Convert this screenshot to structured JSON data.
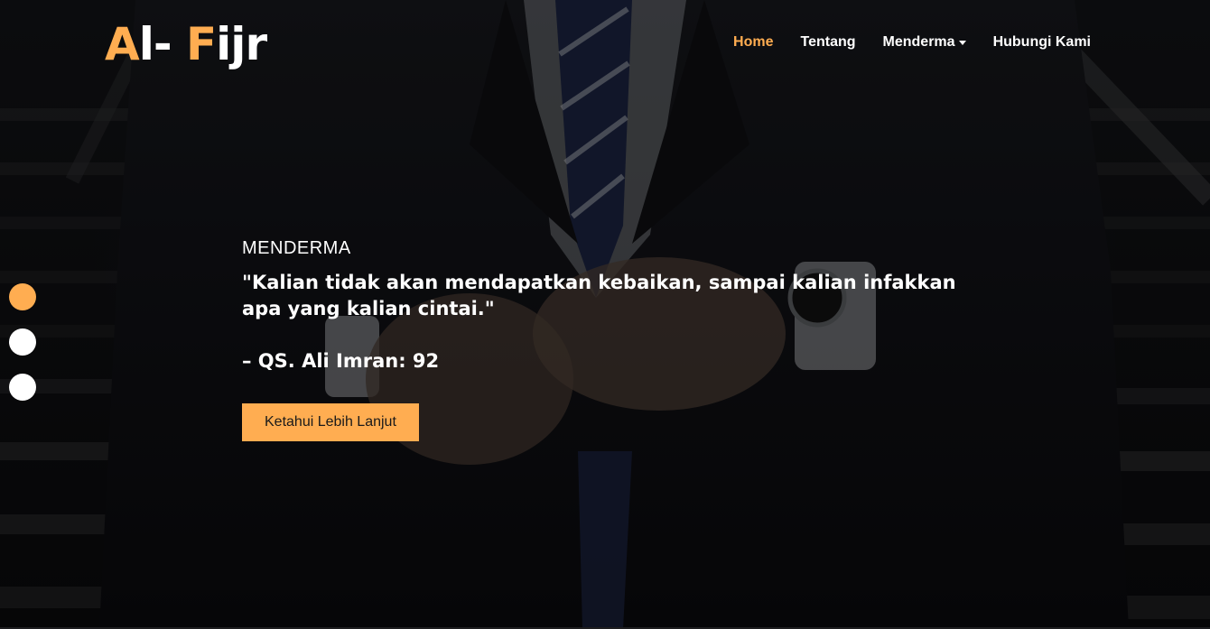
{
  "brand": {
    "part1_accent": "A",
    "part1_rest": "l- ",
    "part2_accent": "F",
    "part2_rest": "ijr"
  },
  "nav": {
    "items": [
      {
        "label": "Home",
        "active": true
      },
      {
        "label": "Tentang",
        "active": false
      },
      {
        "label": "Menderma",
        "active": false,
        "dropdown": true
      },
      {
        "label": "Hubungi Kami",
        "active": false
      }
    ]
  },
  "carousel": {
    "slides_total": 3,
    "active_index": 0,
    "eyebrow": "MENDERMA",
    "quote_line1": "\"Kalian tidak akan mendapatkan kebaikan, sampai kalian infakkan",
    "quote_line2": "apa yang kalian cintai.\"",
    "source": "– QS. Ali Imran: 92",
    "cta_label": "Ketahui Lebih Lanjut"
  },
  "colors": {
    "accent": "#ffad51",
    "text": "#ffffff",
    "background": "#0b0b0d"
  }
}
